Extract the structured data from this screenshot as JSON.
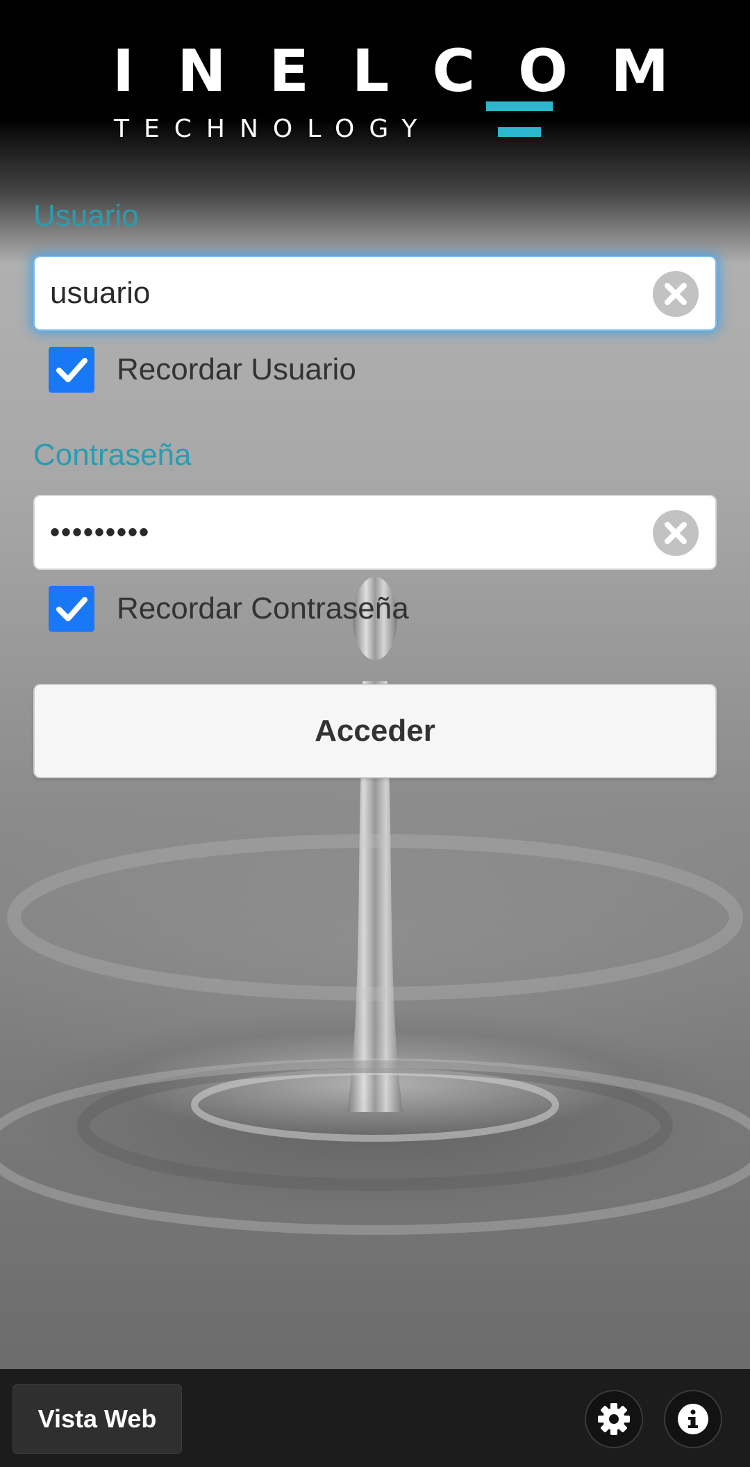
{
  "brand": {
    "name": "INELCOM",
    "tagline": "TECHNOLOGY",
    "accent_color": "#2cb7cf"
  },
  "username": {
    "label": "Usuario",
    "value": "usuario",
    "clear_icon": "clear-icon",
    "remember_label": "Recordar Usuario",
    "remember_checked": true
  },
  "password": {
    "label": "Contraseña",
    "value": "•••••••••",
    "clear_icon": "clear-icon",
    "remember_label": "Recordar Contraseña",
    "remember_checked": true
  },
  "login_button": "Acceder",
  "footer": {
    "web_view_label": "Vista Web",
    "settings_icon": "gear-icon",
    "info_icon": "info-icon"
  },
  "colors": {
    "label": "#2b9cb0",
    "checkbox": "#1978f5",
    "footer_bg": "#1c1c1c"
  }
}
